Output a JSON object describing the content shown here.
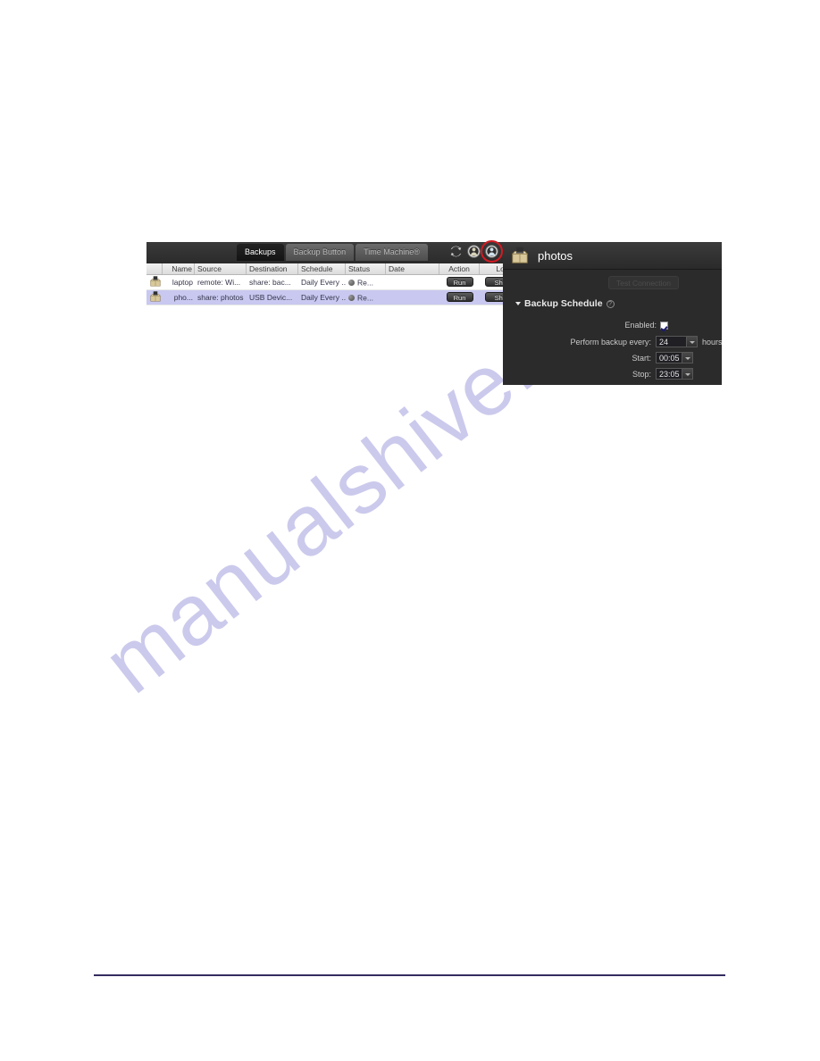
{
  "page": {
    "watermark": "manualshive.com",
    "rule_color": "#332c5e"
  },
  "app": {
    "tabs": [
      {
        "label": "Backups",
        "active": true
      },
      {
        "label": "Backup Button",
        "active": false
      },
      {
        "label": "Time Machine®",
        "active": false
      }
    ],
    "toolbar_icons": [
      {
        "name": "refresh-icon",
        "highlighted": false
      },
      {
        "name": "add-backup-job-icon",
        "highlighted": false
      },
      {
        "name": "restore-backup-job-icon",
        "highlighted": true
      }
    ],
    "table": {
      "columns": [
        "",
        "Name",
        "Source",
        "Destination",
        "Schedule",
        "Status",
        "Date",
        "Action",
        "Log"
      ],
      "rows": [
        {
          "icon": "backup-job-icon",
          "name": "laptop",
          "source": "remote: Wi...",
          "destination": "share: bac...",
          "schedule": "Daily Every ...",
          "status": "Re...",
          "status_dot_color": "#6e6e6e",
          "date": "",
          "action": "Run",
          "log": "Show",
          "selected": false
        },
        {
          "icon": "backup-job-icon",
          "name": "pho...",
          "source": "share: photos",
          "destination": "USB Devic...",
          "schedule": "Daily Every ...",
          "status": "Re...",
          "status_dot_color": "#6e6e6e",
          "date": "",
          "action": "Run",
          "log": "Show",
          "selected": true
        }
      ]
    },
    "detail_panel": {
      "icon": "package-box-icon",
      "title": "photos",
      "test_connection_label": "Test Connection",
      "section": {
        "title": "Backup Schedule",
        "help_glyph": "?",
        "fields": [
          {
            "label": "Enabled:",
            "type": "checkbox",
            "value": true
          },
          {
            "label": "Perform backup every:",
            "type": "select",
            "value": "24",
            "unit": "hours"
          },
          {
            "label": "Start:",
            "type": "select",
            "value": "00:05",
            "unit": ""
          },
          {
            "label": "Stop:",
            "type": "select",
            "value": "23:05",
            "unit": ""
          }
        ]
      }
    }
  }
}
